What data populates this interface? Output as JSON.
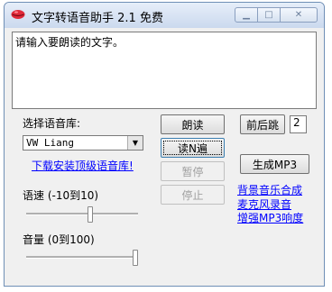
{
  "window": {
    "title": "文字转语音助手 2.1 免费"
  },
  "editor": {
    "placeholder_text": "请输入要朗读的文字。"
  },
  "voice": {
    "label": "选择语音库:",
    "selected": "VW Liang",
    "download_link": "下载安装顶级语音库!"
  },
  "speed": {
    "label": "语速 (-10到10)",
    "value": 0,
    "min": -10,
    "max": 10
  },
  "volume": {
    "label": "音量 (0到100)",
    "value": 100,
    "min": 0,
    "max": 100
  },
  "buttons": {
    "read": "朗读",
    "read_n": "读N遍",
    "pause": "暂停",
    "stop": "停止",
    "jump": "前后跳",
    "jump_value": "2",
    "make_mp3": "生成MP3"
  },
  "links": {
    "bg_music": "背景音乐合成",
    "mic_record": "麦克风录音",
    "mp3_volume": "增强MP3响度"
  }
}
